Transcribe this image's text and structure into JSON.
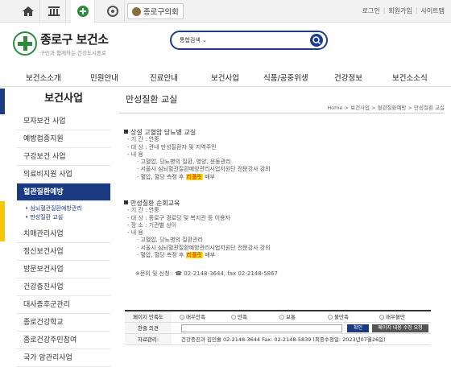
{
  "council": "종로구의회",
  "toplinks": [
    "로그인",
    "회원가입",
    "사이트맵"
  ],
  "logo": {
    "title": "종로구 보건소",
    "subtitle": "구민과 함께하는 건강도시종로"
  },
  "search": {
    "select": "통합검색",
    "placeholder": ""
  },
  "gnb": [
    "보건소소개",
    "민원안내",
    "진료안내",
    "보건사업",
    "식품/공중위생",
    "건강정보",
    "보건소소식"
  ],
  "lnb": {
    "title": "보건사업",
    "items": [
      "모자보건 사업",
      "예방접종지원",
      "구강보건 사업",
      "의료비지원 사업",
      "혈관질환예방",
      "치매관리사업",
      "정신보건사업",
      "방문보건사업",
      "건강증진사업",
      "대사증후군관리",
      "종로건강학교",
      "종로건강주민참여",
      "국가 암관리사업"
    ],
    "active": 4,
    "subs": [
      "• 심뇌혈관질환예방관리",
      "• 만성질환 교실"
    ]
  },
  "page": {
    "title": "만성질환 교실",
    "breadcrumb": "Home > 보건사업 > 혈관질환예방 > 만성질환 교실"
  },
  "sec1": {
    "head": "상설 고혈압 당뇨병 교실",
    "lines": [
      "- 기 간 : 연중",
      "- 대 상 : 관내 만성질환자 및 지역주민",
      "- 내 용"
    ],
    "sub": [
      "· 고혈압, 당뇨병의 질환, 영양, 운동관리",
      "· 서울시 심뇌혈관질환예방관리사업지원단 전문강사 강의"
    ],
    "last_pre": "· 혈압, 혈당 측정 후 ",
    "last_hl": "리플릿",
    "last_post": " 배부"
  },
  "sec2": {
    "head": "만성질환 순회교육",
    "lines": [
      "- 기 간 : 연중",
      "- 대 상 : 종로구 경로당 및 복지관 등 이용자",
      "- 장 소 : 기관별 상이",
      "- 내 용"
    ],
    "sub": [
      "· 고혈압, 당뇨병의 질환관리",
      "· 서울시 심뇌혈관질환예방관리사업지원단 전문강사 강의"
    ],
    "last_pre": "· 혈압, 혈당 측정 후 ",
    "last_hl": "리플릿",
    "last_post": " 배부"
  },
  "contact": "※문의 및 신청 : ☎ 02-2148-3644, fax 02-2148-5867",
  "survey": {
    "satisfaction_label": "페이지 만족도",
    "options": [
      "매우만족",
      "만족",
      "보통",
      "불만족",
      "매우불만"
    ],
    "opinion_label": "한줄 의견",
    "ok": "확인",
    "request": "페이지 내용 수정 요청",
    "manager_label": "자료관리:",
    "manager": "건강증진과 김민솔  02-2148-3644  Fax: 02-2148-5839  (최종수정일: 2023년07월26일)"
  }
}
